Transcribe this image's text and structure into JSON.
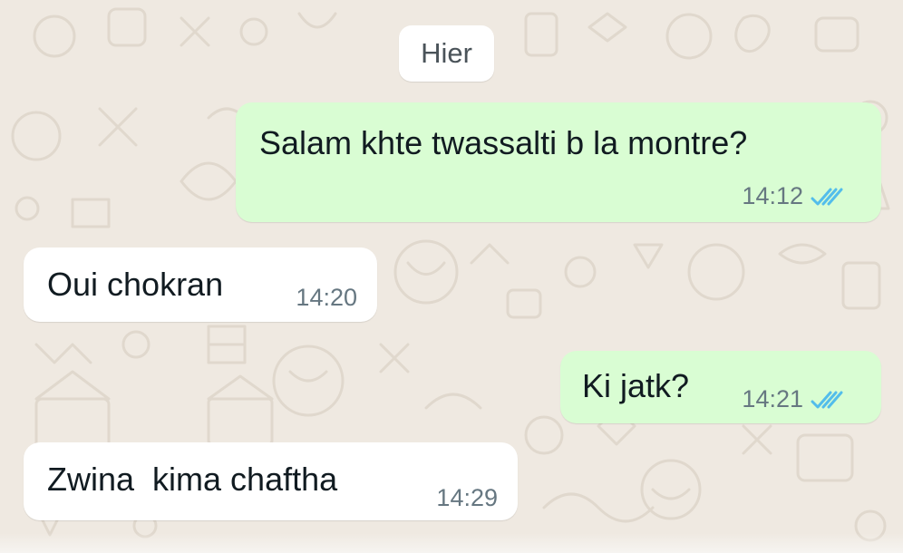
{
  "chat": {
    "date_separator": "Hier",
    "messages": [
      {
        "direction": "outgoing",
        "text": "Salam khte twassalti b la montre?",
        "time": "14:12",
        "status": "read"
      },
      {
        "direction": "incoming",
        "text": "Oui chokran",
        "time": "14:20"
      },
      {
        "direction": "outgoing",
        "text": "Ki jatk?",
        "time": "14:21",
        "status": "read"
      },
      {
        "direction": "incoming",
        "text": "Zwina  kima chaftha",
        "time": "14:29"
      }
    ]
  },
  "colors": {
    "wallpaper": "#efe9e1",
    "outgoing_bubble": "#d9fdd3",
    "incoming_bubble": "#ffffff",
    "read_ticks": "#53bdeb",
    "meta_text": "#667781",
    "message_text": "#111b21"
  },
  "icons": {
    "read_receipt": "double-check-icon"
  }
}
